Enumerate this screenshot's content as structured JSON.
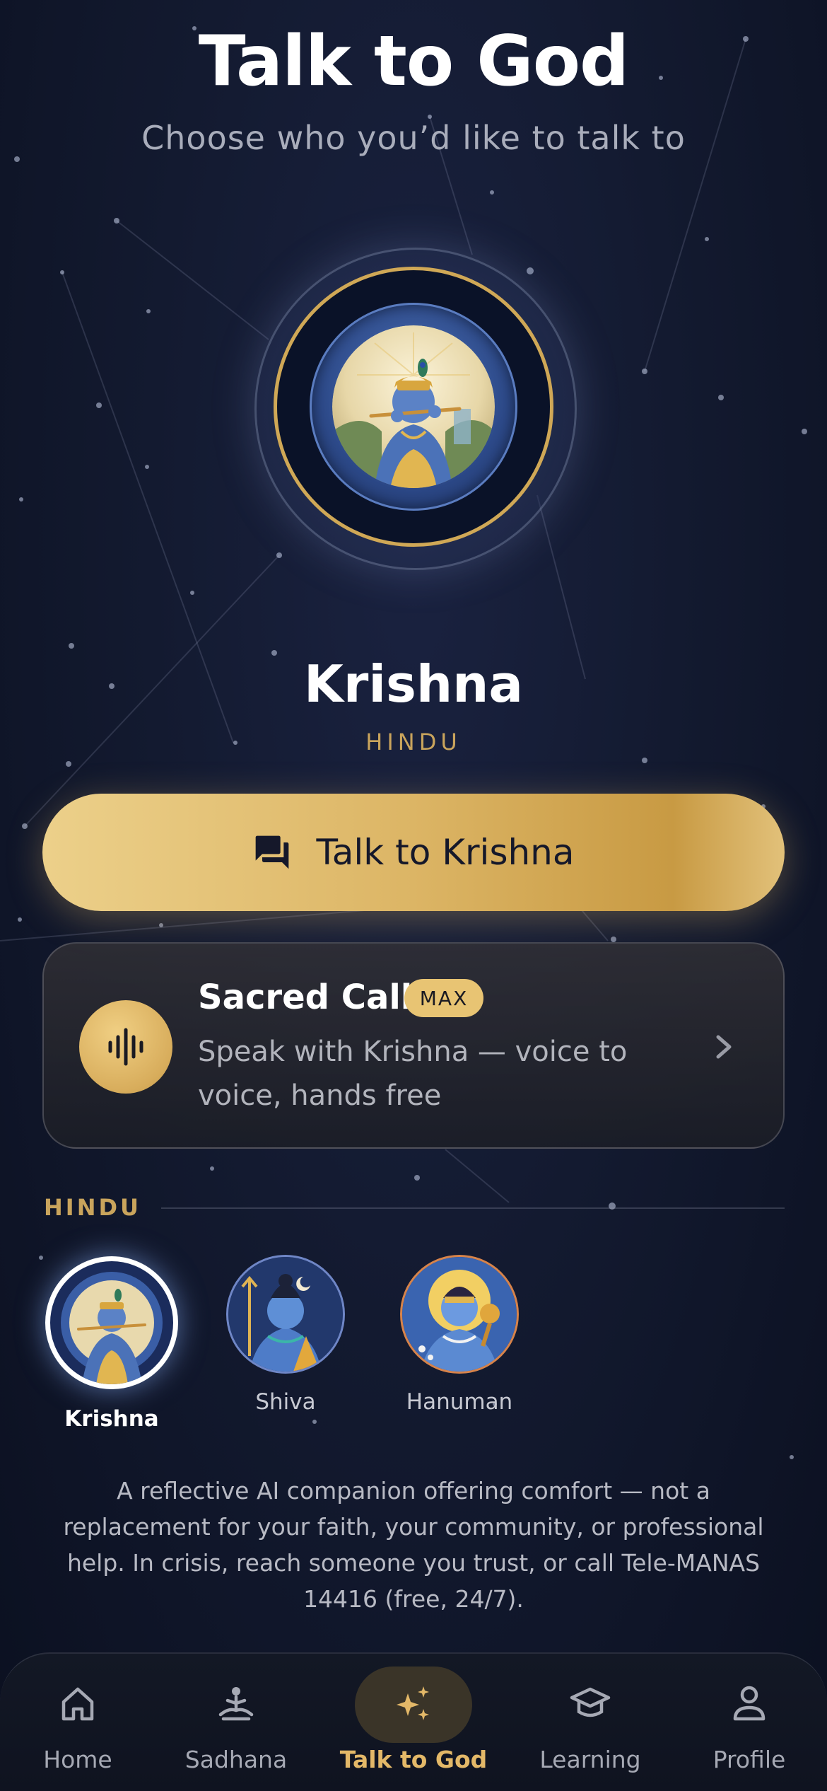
{
  "header": {
    "title": "Talk to God",
    "subtitle": "Choose who you’d like to talk to"
  },
  "selected_deity": {
    "name": "Krishna",
    "tradition": "HINDU"
  },
  "talk_button": {
    "label": "Talk to Krishna",
    "icon": "chat-bubbles-icon"
  },
  "sacred_call": {
    "title": "Sacred Call",
    "badge": "MAX",
    "description": "Speak with Krishna — voice to voice, hands free",
    "icon": "sound-wave-icon"
  },
  "section": {
    "label": "HINDU",
    "deities": [
      {
        "name": "Krishna",
        "selected": true
      },
      {
        "name": "Shiva",
        "selected": false
      },
      {
        "name": "Hanuman",
        "selected": false
      }
    ]
  },
  "disclaimer": "A reflective AI companion offering comfort — not a replacement for your faith, your community, or professional help. In crisis, reach someone you trust, or call Tele-MANAS 14416 (free, 24/7).",
  "tabbar": {
    "items": [
      {
        "label": "Home",
        "icon": "home-icon"
      },
      {
        "label": "Sadhana",
        "icon": "meditation-icon"
      },
      {
        "label": "Talk to God",
        "icon": "sparkles-icon",
        "active": true
      },
      {
        "label": "Learning",
        "icon": "graduation-cap-icon"
      },
      {
        "label": "Profile",
        "icon": "profile-icon"
      }
    ]
  },
  "colors": {
    "background": "#131a30",
    "gold_accent": "#d6b060",
    "title_text": "#ffffff",
    "muted_text": "#a9adbb"
  }
}
